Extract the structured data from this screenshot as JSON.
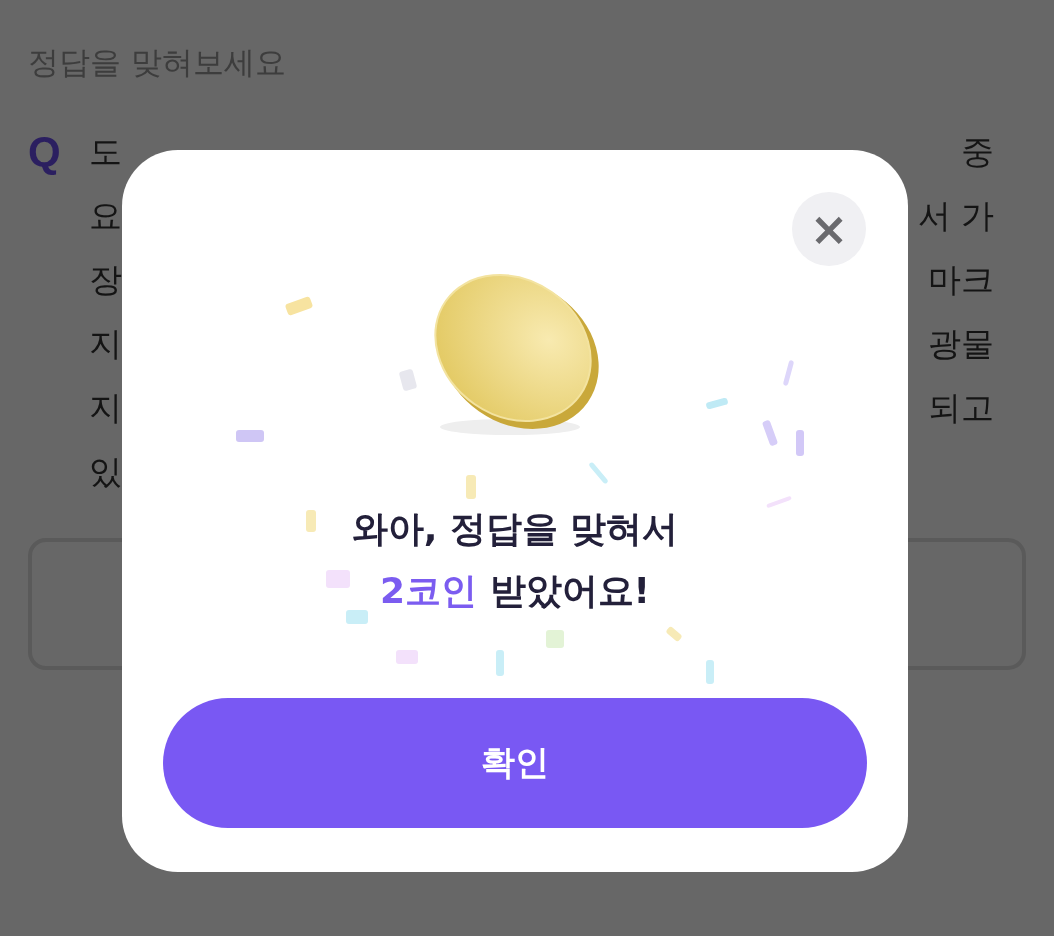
{
  "header": {
    "title": "정답을 맞혀보세요"
  },
  "question": {
    "marker": "Q",
    "lines": [
      {
        "left": "도",
        "right": "중"
      },
      {
        "left": "요",
        "right": "서 가"
      },
      {
        "left": "장",
        "right": "마크"
      },
      {
        "left": "지",
        "right": "광물"
      },
      {
        "left": "지",
        "right": "되고"
      },
      {
        "left": "있"
      }
    ]
  },
  "answer_box": {
    "kind": "empty"
  },
  "dialog": {
    "close": "×",
    "message_line": "와아, 정답을 맞혀서",
    "reward": {
      "highlight": "2코인",
      "rest": " 받았어요!"
    },
    "confirm": "확인"
  }
}
